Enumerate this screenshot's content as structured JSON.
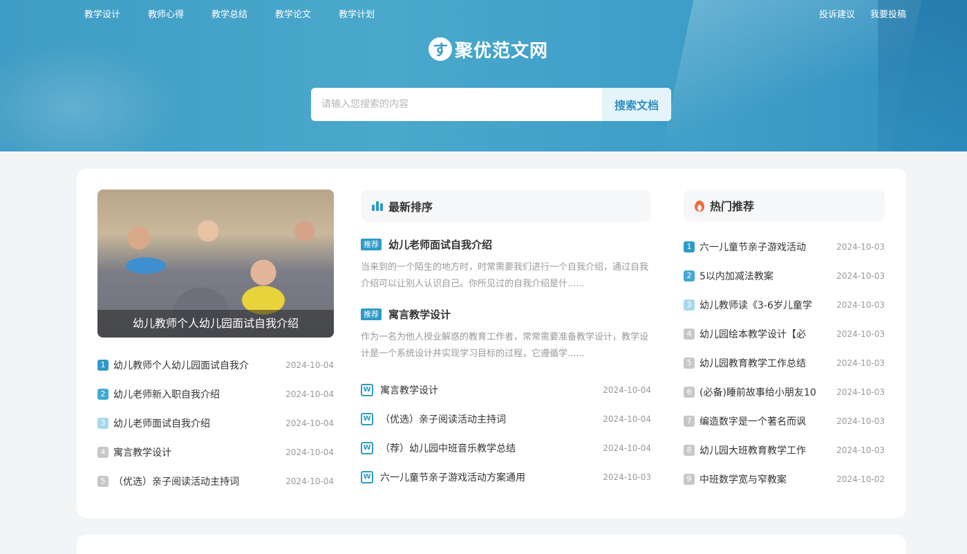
{
  "nav": {
    "left": [
      "教学设计",
      "教师心得",
      "教学总结",
      "教学论文",
      "教学计划"
    ],
    "right": [
      "投诉建议",
      "我要投稿"
    ]
  },
  "logo": {
    "mark": "す",
    "text": "聚优范文网"
  },
  "search": {
    "placeholder": "请输入您搜索的内容",
    "button": "搜索文档"
  },
  "hero": {
    "caption": "幼儿教师个人幼儿园面试自我介绍"
  },
  "left_list": [
    {
      "num": "1",
      "title": "幼儿教师个人幼儿园面试自我介",
      "date": "2024-10-04"
    },
    {
      "num": "2",
      "title": "幼儿老师新入职自我介绍",
      "date": "2024-10-04"
    },
    {
      "num": "3",
      "title": "幼儿老师面试自我介绍",
      "date": "2024-10-04"
    },
    {
      "num": "4",
      "title": "寓言教学设计",
      "date": "2024-10-04"
    },
    {
      "num": "5",
      "title": "（优选）亲子阅读活动主持词",
      "date": "2024-10-04"
    }
  ],
  "latest": {
    "heading": "最新排序",
    "recommended": [
      {
        "tag": "推荐",
        "title": "幼儿老师面试自我介绍",
        "desc": "当来到的一个陌生的地方时，时常需要我们进行一个自我介绍，通过自我介绍可以让别人认识自己。你所见过的自我介绍是什......"
      },
      {
        "tag": "推荐",
        "title": "寓言教学设计",
        "desc": "作为一名为他人授业解惑的教育工作者，常常需要准备教学设计，教学设计是一个系统设计并实现学习目标的过程，它遵循学......"
      }
    ],
    "items": [
      {
        "title": "寓言教学设计",
        "date": "2024-10-04"
      },
      {
        "title": "（优选）亲子阅读活动主持词",
        "date": "2024-10-04"
      },
      {
        "title": "（荐）幼儿园中班音乐教学总结",
        "date": "2024-10-04"
      },
      {
        "title": "六一儿童节亲子游戏活动方案通用",
        "date": "2024-10-03"
      }
    ]
  },
  "hot": {
    "heading": "热门推荐",
    "items": [
      {
        "num": "1",
        "title": "六一儿童节亲子游戏活动",
        "date": "2024-10-03"
      },
      {
        "num": "2",
        "title": "5以内加减法教案",
        "date": "2024-10-03"
      },
      {
        "num": "3",
        "title": "幼儿教师读《3-6岁儿童学",
        "date": "2024-10-03"
      },
      {
        "num": "4",
        "title": "幼儿园绘本教学设计【必",
        "date": "2024-10-03"
      },
      {
        "num": "5",
        "title": "幼儿园教育教学工作总结",
        "date": "2024-10-03"
      },
      {
        "num": "6",
        "title": "(必备)睡前故事给小朋友10",
        "date": "2024-10-03"
      },
      {
        "num": "7",
        "title": "编造数字是一个著名而讽",
        "date": "2024-10-03"
      },
      {
        "num": "8",
        "title": "幼儿园大班教育教学工作",
        "date": "2024-10-03"
      },
      {
        "num": "9",
        "title": "中班数学宽与窄教案",
        "date": "2024-10-02"
      }
    ]
  },
  "icons": {
    "w": "W"
  },
  "colors": {
    "accent": "#2e9ac7",
    "banner": "#3f9cc4",
    "hot": "#f06a3c"
  }
}
